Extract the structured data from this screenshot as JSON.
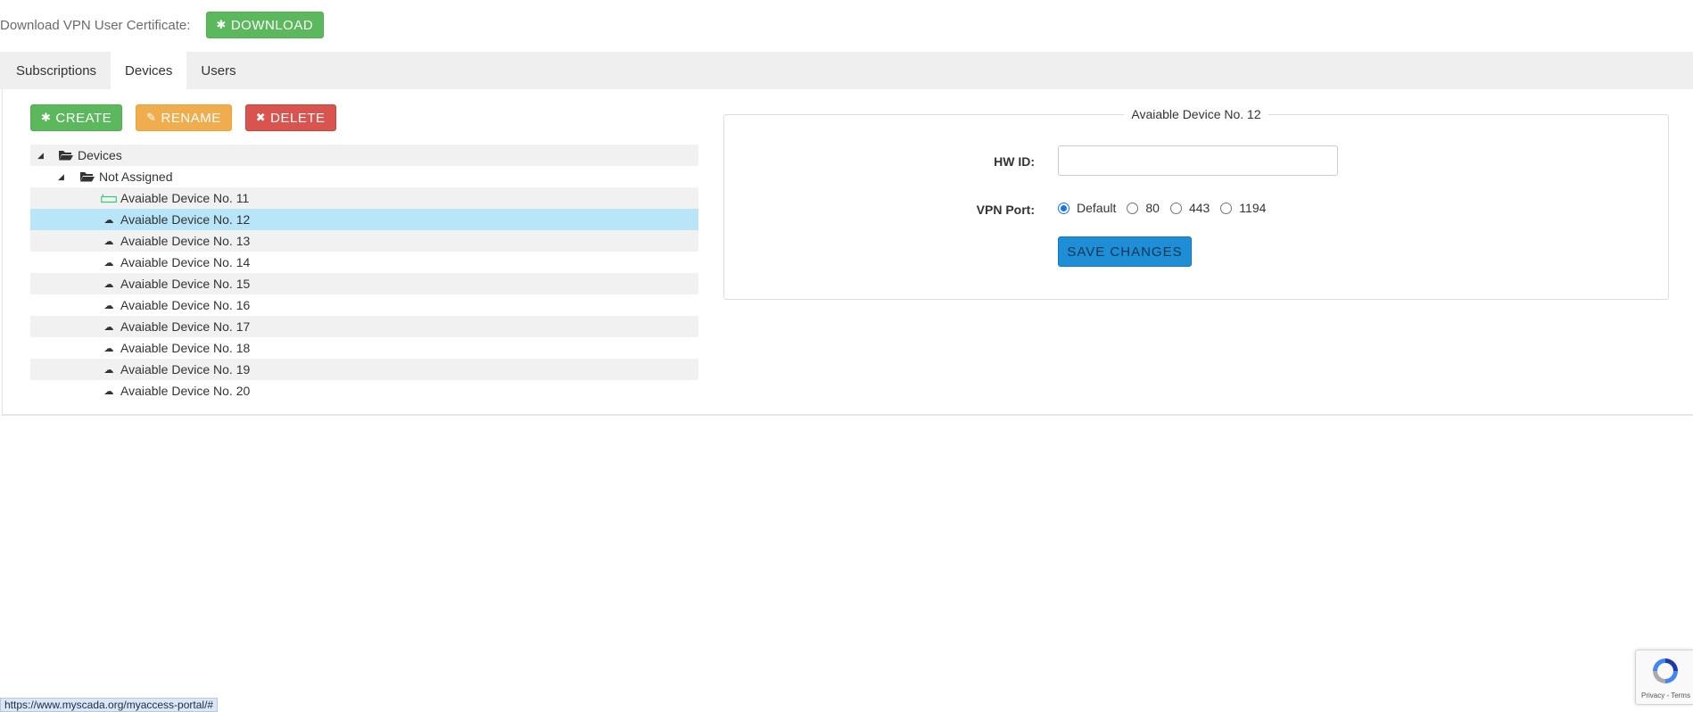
{
  "header": {
    "certificate_label": "Download VPN User Certificate:",
    "download_label": "DOWNLOAD"
  },
  "tabs": [
    {
      "label": "Subscriptions",
      "active": false
    },
    {
      "label": "Devices",
      "active": true
    },
    {
      "label": "Users",
      "active": false
    }
  ],
  "toolbar": {
    "create_label": "CREATE",
    "rename_label": "RENAME",
    "delete_label": "DELETE"
  },
  "tree": {
    "root": {
      "label": "Devices"
    },
    "group": {
      "label": "Not Assigned"
    },
    "devices": [
      {
        "label": "Avaiable Device No. 11",
        "icon": "router-icon",
        "selected": false
      },
      {
        "label": "Avaiable Device No. 12",
        "icon": "cloud-icon",
        "selected": true
      },
      {
        "label": "Avaiable Device No. 13",
        "icon": "cloud-icon",
        "selected": false
      },
      {
        "label": "Avaiable Device No. 14",
        "icon": "cloud-icon",
        "selected": false
      },
      {
        "label": "Avaiable Device No. 15",
        "icon": "cloud-icon",
        "selected": false
      },
      {
        "label": "Avaiable Device No. 16",
        "icon": "cloud-icon",
        "selected": false
      },
      {
        "label": "Avaiable Device No. 17",
        "icon": "cloud-icon",
        "selected": false
      },
      {
        "label": "Avaiable Device No. 18",
        "icon": "cloud-icon",
        "selected": false
      },
      {
        "label": "Avaiable Device No. 19",
        "icon": "cloud-icon",
        "selected": false
      },
      {
        "label": "Avaiable Device No. 20",
        "icon": "cloud-icon",
        "selected": false
      }
    ]
  },
  "detail": {
    "legend": "Avaiable Device No. 12",
    "hw_id_label": "HW ID:",
    "hw_id_value": "",
    "vpn_port_label": "VPN Port:",
    "vpn_port_options": [
      {
        "label": "Default",
        "checked": true
      },
      {
        "label": "80",
        "checked": false
      },
      {
        "label": "443",
        "checked": false
      },
      {
        "label": "1194",
        "checked": false
      }
    ],
    "save_label": "SAVE CHANGES"
  },
  "statusbar": {
    "url": "https://www.myscada.org/myaccess-portal/#"
  },
  "recaptcha": {
    "links": "Privacy - Terms"
  },
  "colors": {
    "green": "#5cb85c",
    "orange": "#f0ad4e",
    "red": "#d9534f",
    "blue": "#1e8fd6",
    "selected_row": "#b8e6f8"
  }
}
